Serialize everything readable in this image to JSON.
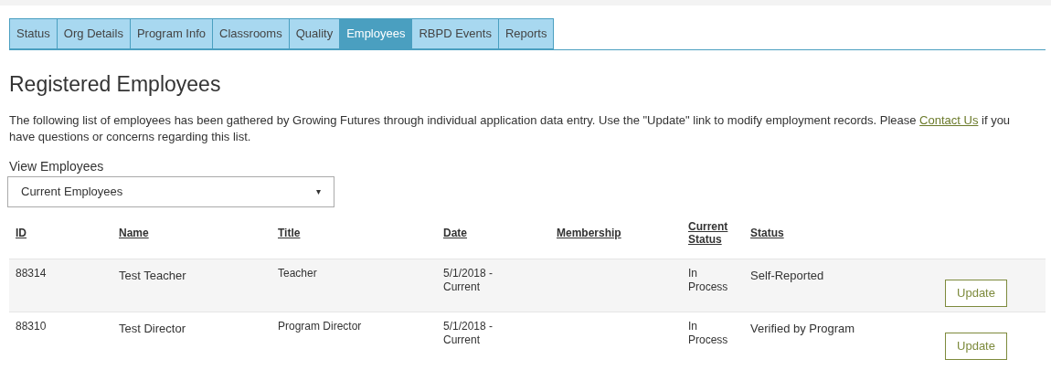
{
  "tabs": [
    {
      "label": "Status",
      "selected": false
    },
    {
      "label": "Org Details",
      "selected": false
    },
    {
      "label": "Program Info",
      "selected": false
    },
    {
      "label": "Classrooms",
      "selected": false
    },
    {
      "label": "Quality",
      "selected": false
    },
    {
      "label": "Employees",
      "selected": true
    },
    {
      "label": "RBPD Events",
      "selected": false
    },
    {
      "label": "Reports",
      "selected": false
    }
  ],
  "heading": "Registered Employees",
  "intro": {
    "before": "The following list of employees has been gathered by Growing Futures through individual application data entry. Use the \"Update\" link to modify employment records. Please",
    "link": "Contact Us",
    "after": "if you have questions or concerns regarding this list."
  },
  "filter": {
    "label": "View Employees",
    "value": "Current Employees",
    "caret": "▾"
  },
  "table": {
    "columns": [
      "ID",
      "Name",
      "Title",
      "Date",
      "Membership",
      "Current Status",
      "Status"
    ],
    "rows": [
      {
        "id": "88314",
        "name": "Test Teacher",
        "title": "Teacher",
        "date": "5/1/2018 - Current",
        "current_status": "In Process",
        "status": "Self-Reported",
        "action": "Update"
      },
      {
        "id": "88310",
        "name": "Test Director",
        "title": "Program Director",
        "date": "5/1/2018 - Current",
        "current_status": "In Process",
        "status": "Verified by Program",
        "action": "Update"
      }
    ]
  }
}
